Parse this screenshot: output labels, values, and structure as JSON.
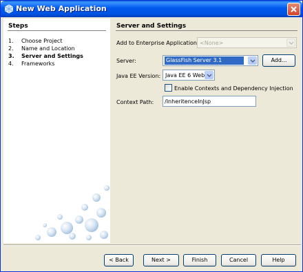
{
  "window": {
    "title": "New Web Application",
    "title_icon": "netbeans-icon",
    "titlebar_color": "#0054e3"
  },
  "steps": {
    "title": "Steps",
    "items": [
      {
        "num": "1.",
        "label": "Choose Project"
      },
      {
        "num": "2.",
        "label": "Name and Location"
      },
      {
        "num": "3.",
        "label": "Server and Settings"
      },
      {
        "num": "4.",
        "label": "Frameworks"
      }
    ],
    "current_index": 2
  },
  "panel": {
    "title": "Server and Settings",
    "enterprise_label": "Add to Enterprise Application:",
    "enterprise_value": "<None>",
    "server_label": "Server:",
    "server_value": "GlassFish Server 3.1",
    "add_button": "Add...",
    "javaee_label": "Java EE Version:",
    "javaee_value": "Java EE 6 Web",
    "cdi_label": "Enable Contexts and Dependency Injection",
    "cdi_checked": false,
    "context_label": "Context Path:",
    "context_value": "/InheritenceInJsp"
  },
  "buttons": {
    "back": "< Back",
    "next": "Next >",
    "finish": "Finish",
    "cancel": "Cancel",
    "help": "Help"
  },
  "colors": {
    "selection": "#316ac5",
    "dialog_bg": "#ece9d8",
    "close_button": "#d1442b"
  }
}
